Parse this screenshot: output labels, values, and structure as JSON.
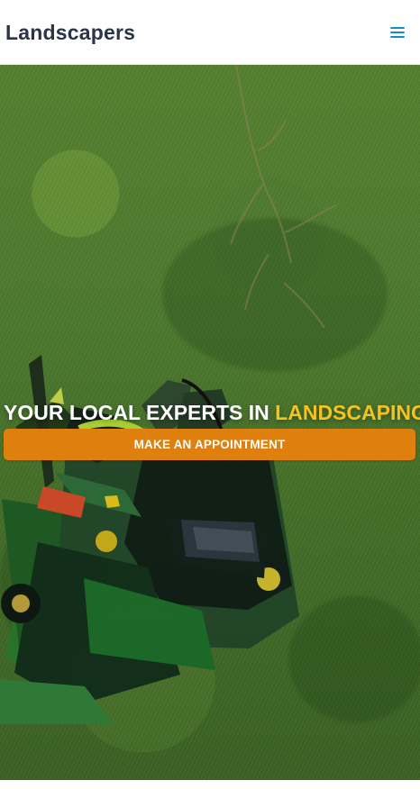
{
  "header": {
    "brand": "Landscapers",
    "menu_icon": "menu-icon"
  },
  "hero": {
    "title_prefix": "YOUR LOCAL EXPERTS IN ",
    "title_highlight": "LANDSCAPING",
    "button_label": "MAKE AN APPOINTMENT"
  },
  "colors": {
    "brand_text": "#2a3446",
    "menu": "#0f8fc8",
    "highlight": "#f5c21f",
    "cta": "#df7f0d"
  }
}
